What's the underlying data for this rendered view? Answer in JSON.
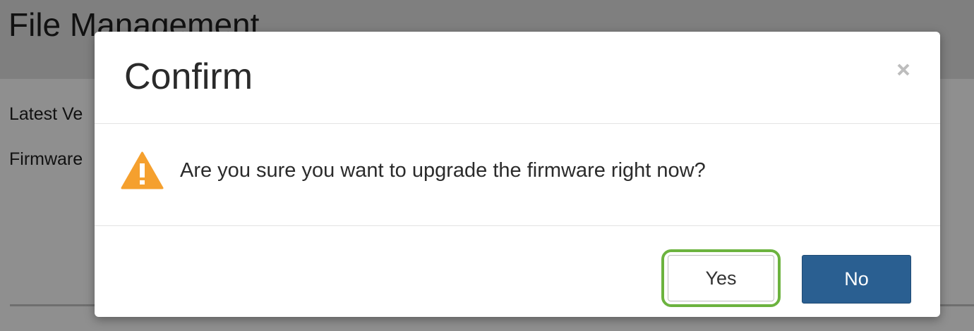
{
  "background": {
    "page_title": "File Management",
    "labels": [
      "Latest Ve",
      "Firmware"
    ]
  },
  "dialog": {
    "title": "Confirm",
    "close_glyph": "×",
    "message": "Are you sure you want to upgrade the firmware right now?",
    "warning_icon": "warning-triangle-icon",
    "yes_label": "Yes",
    "no_label": "No"
  },
  "colors": {
    "primary_button": "#2a5f91",
    "highlight_ring": "#6cb33f",
    "warning": "#f5a02e",
    "overlay": "#8f8f8f"
  }
}
